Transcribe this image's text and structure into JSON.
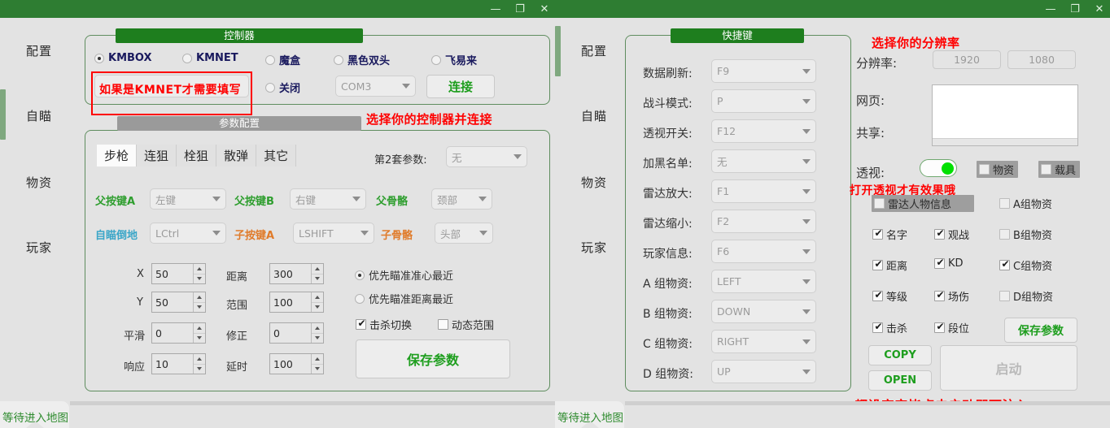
{
  "window": {
    "minimize": "—",
    "maximize": "❐",
    "close": "✕"
  },
  "sidebar": {
    "items": [
      {
        "label": "配置"
      },
      {
        "label": "自瞄"
      },
      {
        "label": "物资"
      },
      {
        "label": "玩家"
      }
    ]
  },
  "left_panel": {
    "controller_group": {
      "title": "控制器",
      "radios": [
        {
          "label": "KMBOX",
          "checked": true
        },
        {
          "label": "KMNET",
          "checked": false
        },
        {
          "label": "魔盒",
          "checked": false
        },
        {
          "label": "黑色双头",
          "checked": false
        },
        {
          "label": "飞易来",
          "checked": false
        }
      ],
      "close_radio": {
        "label": "关闭",
        "checked": false
      },
      "ip_input_value": "",
      "com_port": "COM3",
      "connect_button": "连接",
      "annotation_ip": "如果是KMNET才需要填写",
      "annotation_side": "选择你的控制器并连接"
    },
    "params_group": {
      "title": "参数配置",
      "tabs": [
        {
          "label": "步枪",
          "active": true
        },
        {
          "label": "连狙",
          "active": false
        },
        {
          "label": "栓狙",
          "active": false
        },
        {
          "label": "散弹",
          "active": false
        },
        {
          "label": "其它",
          "active": false
        }
      ],
      "second_set_label": "第2套参数:",
      "second_set_value": "无",
      "key_rows": [
        {
          "label": "父按键A",
          "label_color": "#2e9e2e",
          "value": "左键"
        },
        {
          "label": "父按键B",
          "label_color": "#2e9e2e",
          "value": "右键"
        },
        {
          "label": "父骨骼",
          "label_color": "#2e9e2e",
          "value": "颈部"
        },
        {
          "label": "自瞄倒地",
          "label_color": "#3aa6c8",
          "value": "LCtrl"
        },
        {
          "label": "子按键A",
          "label_color": "#e07b2a",
          "value": "LSHIFT"
        },
        {
          "label": "子骨骼",
          "label_color": "#e07b2a",
          "value": "头部"
        }
      ],
      "numeric_left": [
        {
          "label": "X",
          "value": "50"
        },
        {
          "label": "Y",
          "value": "50"
        },
        {
          "label": "平滑",
          "value": "0"
        },
        {
          "label": "响应",
          "value": "10"
        }
      ],
      "numeric_right": [
        {
          "label": "距离",
          "value": "300"
        },
        {
          "label": "范围",
          "value": "100"
        },
        {
          "label": "修正",
          "value": "0"
        },
        {
          "label": "延时",
          "value": "100"
        }
      ],
      "aim_radios": [
        {
          "label": "优先瞄准准心最近",
          "checked": true
        },
        {
          "label": "优先瞄准距离最近",
          "checked": false
        }
      ],
      "aim_checks": [
        {
          "label": "击杀切换",
          "checked": true
        },
        {
          "label": "动态范围",
          "checked": false
        }
      ],
      "save_button": "保存参数"
    },
    "status": "等待进入地图"
  },
  "right_panel": {
    "hotkey_group": {
      "title": "快捷键",
      "rows": [
        {
          "label": "数据刷新:",
          "value": "F9"
        },
        {
          "label": "战斗模式:",
          "value": "P"
        },
        {
          "label": "透视开关:",
          "value": "F12"
        },
        {
          "label": "加黑名单:",
          "value": "无"
        },
        {
          "label": "雷达放大:",
          "value": "F1"
        },
        {
          "label": "雷达缩小:",
          "value": "F2"
        },
        {
          "label": "玩家信息:",
          "value": "F6"
        },
        {
          "label": "A 组物资:",
          "value": "LEFT"
        },
        {
          "label": "B 组物资:",
          "value": "DOWN"
        },
        {
          "label": "C 组物资:",
          "value": "RIGHT"
        },
        {
          "label": "D 组物资:",
          "value": "UP"
        }
      ]
    },
    "settings": {
      "resolution_label": "分辨率:",
      "resolution_width": "1920",
      "resolution_height": "1080",
      "webpage_label": "网页:",
      "share_label": "共享:",
      "webpage_value": "",
      "esp_label": "透视:",
      "esp_on": true,
      "esp_checks": [
        {
          "label": "物资",
          "checked": false
        },
        {
          "label": "载具",
          "checked": false
        }
      ],
      "radar_info": {
        "label": "雷达人物信息",
        "checked": false
      },
      "info_checks": [
        {
          "label": "名字",
          "checked": true
        },
        {
          "label": "观战",
          "checked": true
        },
        {
          "label": "A组物资",
          "checked": false
        },
        {
          "label": "距离",
          "checked": true
        },
        {
          "label": "KD",
          "checked": true
        },
        {
          "label": "B组物资",
          "checked": false
        },
        {
          "label": "等级",
          "checked": true
        },
        {
          "label": "场伤",
          "checked": true
        },
        {
          "label": "C组物资",
          "checked": true
        },
        {
          "label": "击杀",
          "checked": true
        },
        {
          "label": "段位",
          "checked": true
        },
        {
          "label": "D组物资",
          "checked": false
        }
      ],
      "save_button": "保存参数",
      "copy_button": "COPY",
      "open_button": "OPEN",
      "start_button": "启动",
      "annotation_resolution": "选择你的分辨率",
      "annotation_esp": "打开透视才有效果哦",
      "annotation_start": "都设定完毕点击启动即可注入"
    },
    "status": "等待进入地图"
  }
}
